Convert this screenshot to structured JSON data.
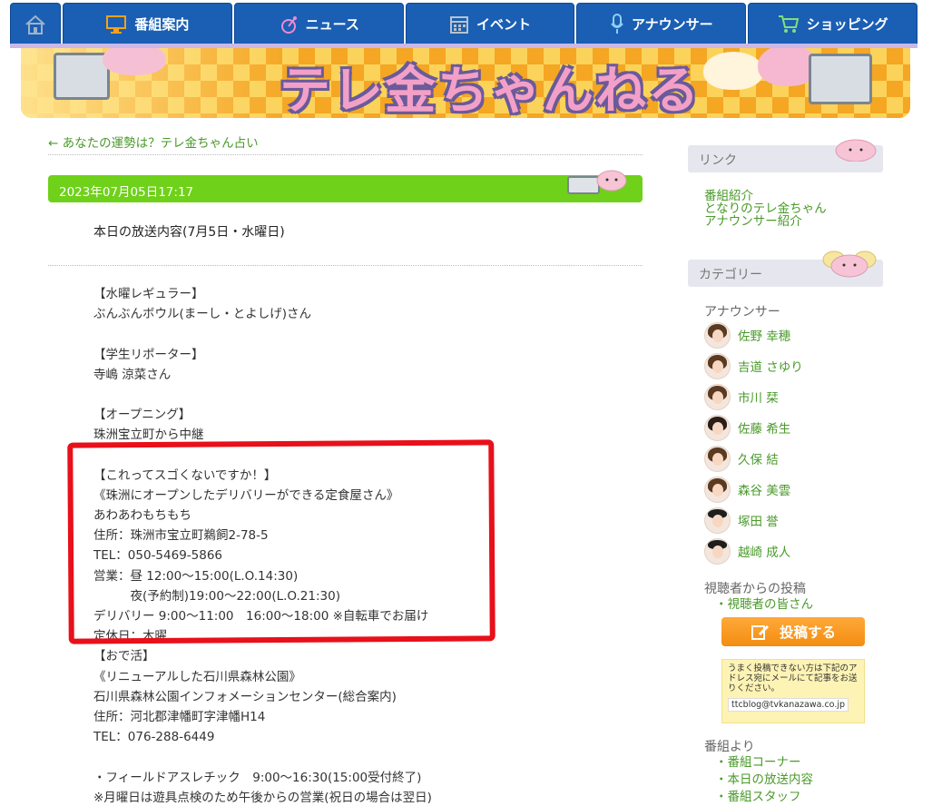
{
  "nav": {
    "items": [
      {
        "label": "番組案内",
        "icon": "monitor-icon"
      },
      {
        "label": "ニュース",
        "icon": "satellite-icon"
      },
      {
        "label": "イベント",
        "icon": "calendar-icon"
      },
      {
        "label": "アナウンサー",
        "icon": "microphone-icon"
      },
      {
        "label": "ショッピング",
        "icon": "cart-icon"
      }
    ]
  },
  "banner": {
    "title": "テレ金ちゃんねる"
  },
  "article": {
    "back_link": "← あなたの運勢は？テレ金ちゃん占い",
    "date": "2023年07月05日17:17",
    "title": "本日の放送内容(7月5日・水曜日)",
    "lines": [
      "【水曜レギュラー】",
      "ぶんぶんボウル(まーし・とよしげ)さん",
      "",
      "【学生リポーター】",
      "寺嶋 涼菜さん",
      "",
      "【オープニング】",
      "珠洲宝立町から中継",
      "",
      "【これってスゴくないですか！】",
      "《珠洲にオープンしたデリバリーができる定食屋さん》",
      "あわあわもちもち",
      "住所：珠洲市宝立町鵜飼2-78-5",
      "TEL：050-5469-5866",
      "営業：昼 12:00～15:00(L.O.14:30)",
      "　　　夜(予約制)19:00～22:00(L.O.21:30)",
      "デリバリー 9:00～11:00　16:00～18:00 ※自転車でお届け",
      "定休日：木曜",
      "【おで活】",
      "《リニューアルした石川県森林公園》",
      "石川県森林公園インフォメーションセンター(総合案内)",
      "住所：河北郡津幡町字津幡H14",
      "TEL：076-288-6449",
      "",
      "・フィールドアスレチック　9:00～16:30(15:00受付終了)",
      "※月曜日は遊具点検のため午後からの営業(祝日の場合は翌日)"
    ]
  },
  "sidebar": {
    "links_heading": "リンク",
    "links": [
      "番組紹介",
      "となりのテレ金ちゃん",
      "アナウンサー紹介"
    ],
    "category_heading": "カテゴリー",
    "announcer_label": "アナウンサー",
    "announcers": [
      "佐野 幸穂",
      "吉道 さゆり",
      "市川 栞",
      "佐藤 希生",
      "久保 結",
      "森谷 美雲",
      "塚田 誉",
      "越崎 成人"
    ],
    "viewer_label": "視聴者からの投稿",
    "viewer_link": "・視聴者の皆さん",
    "post_button": "投稿する",
    "note": "うまく投稿できない方は下記のアドレス宛にメールにて記事をお送りください。",
    "email": "ttcblog@tvkanazawa.co.jp",
    "program_label": "番組より",
    "program_links": [
      "・番組コーナー",
      "・本日の放送内容",
      "・番組スタッフ"
    ]
  },
  "colors": {
    "nav": "#1a5fb4",
    "date_bar": "#6fd11a",
    "link": "#4a9a2a",
    "highlight": "#e8101a",
    "button": "#f38d10"
  }
}
